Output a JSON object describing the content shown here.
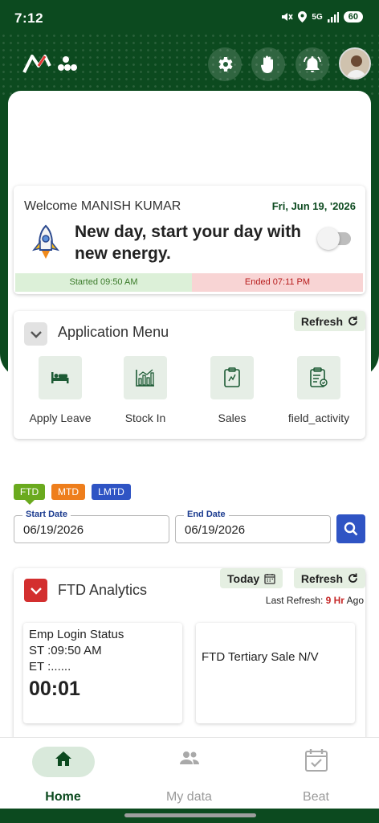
{
  "status_bar": {
    "time": "7:12",
    "network": "5G",
    "battery": "60"
  },
  "welcome": {
    "greeting": "Welcome MANISH KUMAR",
    "date": "Fri, Jun 19, '2026",
    "motto": "New day, start your day with new energy.",
    "started": "Started 09:50 AM",
    "ended": "Ended 07:11 PM"
  },
  "app_menu": {
    "title": "Application Menu",
    "refresh_label": "Refresh",
    "items": [
      {
        "label": "Apply Leave",
        "icon": "bed-icon"
      },
      {
        "label": "Stock In",
        "icon": "chart-icon"
      },
      {
        "label": "Sales",
        "icon": "clipboard-icon"
      },
      {
        "label": "field_activity",
        "icon": "checklist-icon"
      }
    ]
  },
  "filters": {
    "tabs": [
      "FTD",
      "MTD",
      "LMTD"
    ],
    "selected": "FTD",
    "start_label": "Start Date",
    "start_value": "06/19/2026",
    "end_label": "End Date",
    "end_value": "06/19/2026"
  },
  "analytics": {
    "title": "FTD Analytics",
    "today_label": "Today",
    "refresh_label": "Refresh",
    "last_refresh_prefix": "Last Refresh:",
    "last_refresh_value": "9 Hr",
    "last_refresh_suffix": "Ago",
    "login_card": {
      "title": "Emp Login Status",
      "st": "ST :09:50 AM",
      "et": "ET :......",
      "duration": "00:01"
    },
    "sale_card": {
      "title": "FTD Tertiary Sale N/V"
    }
  },
  "bottom_nav": {
    "items": [
      {
        "label": "Home",
        "active": true
      },
      {
        "label": "My data",
        "active": false
      },
      {
        "label": "Beat",
        "active": false
      }
    ]
  },
  "colors": {
    "brand": "#0c4a1f",
    "accent_blue": "#2f54c4",
    "alert_red": "#d32f2f"
  }
}
